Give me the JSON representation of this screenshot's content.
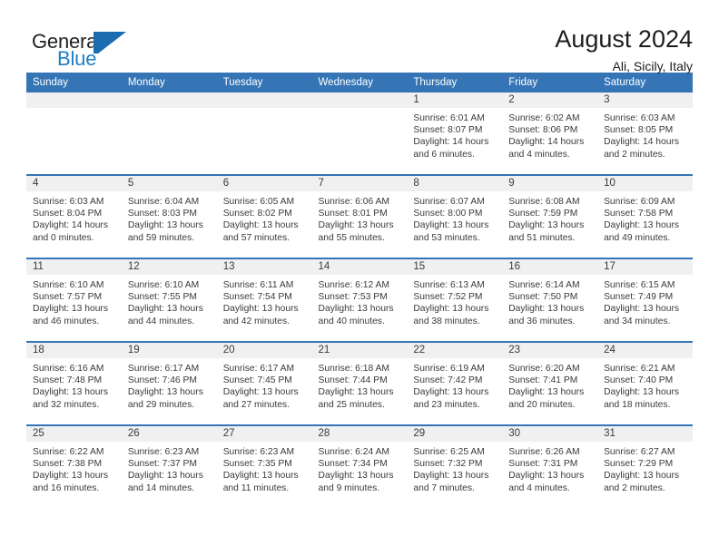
{
  "brand": {
    "name_top": "General",
    "name_bottom": "Blue",
    "logo_icon": "sail-triangle-icon",
    "accent_color": "#1f7fc4"
  },
  "header": {
    "title": "August 2024",
    "subtitle": "Ali, Sicily, Italy"
  },
  "theme": {
    "header_bg": "#3575b5",
    "header_text": "#ffffff",
    "daynum_bg": "#f0f0f0",
    "row_rule": "#3575b5"
  },
  "weekdays": [
    "Sunday",
    "Monday",
    "Tuesday",
    "Wednesday",
    "Thursday",
    "Friday",
    "Saturday"
  ],
  "weeks": [
    [
      {
        "empty": true
      },
      {
        "empty": true
      },
      {
        "empty": true
      },
      {
        "empty": true
      },
      {
        "day": "1",
        "sunrise": "Sunrise: 6:01 AM",
        "sunset": "Sunset: 8:07 PM",
        "daylight1": "Daylight: 14 hours",
        "daylight2": "and 6 minutes."
      },
      {
        "day": "2",
        "sunrise": "Sunrise: 6:02 AM",
        "sunset": "Sunset: 8:06 PM",
        "daylight1": "Daylight: 14 hours",
        "daylight2": "and 4 minutes."
      },
      {
        "day": "3",
        "sunrise": "Sunrise: 6:03 AM",
        "sunset": "Sunset: 8:05 PM",
        "daylight1": "Daylight: 14 hours",
        "daylight2": "and 2 minutes."
      }
    ],
    [
      {
        "day": "4",
        "sunrise": "Sunrise: 6:03 AM",
        "sunset": "Sunset: 8:04 PM",
        "daylight1": "Daylight: 14 hours",
        "daylight2": "and 0 minutes."
      },
      {
        "day": "5",
        "sunrise": "Sunrise: 6:04 AM",
        "sunset": "Sunset: 8:03 PM",
        "daylight1": "Daylight: 13 hours",
        "daylight2": "and 59 minutes."
      },
      {
        "day": "6",
        "sunrise": "Sunrise: 6:05 AM",
        "sunset": "Sunset: 8:02 PM",
        "daylight1": "Daylight: 13 hours",
        "daylight2": "and 57 minutes."
      },
      {
        "day": "7",
        "sunrise": "Sunrise: 6:06 AM",
        "sunset": "Sunset: 8:01 PM",
        "daylight1": "Daylight: 13 hours",
        "daylight2": "and 55 minutes."
      },
      {
        "day": "8",
        "sunrise": "Sunrise: 6:07 AM",
        "sunset": "Sunset: 8:00 PM",
        "daylight1": "Daylight: 13 hours",
        "daylight2": "and 53 minutes."
      },
      {
        "day": "9",
        "sunrise": "Sunrise: 6:08 AM",
        "sunset": "Sunset: 7:59 PM",
        "daylight1": "Daylight: 13 hours",
        "daylight2": "and 51 minutes."
      },
      {
        "day": "10",
        "sunrise": "Sunrise: 6:09 AM",
        "sunset": "Sunset: 7:58 PM",
        "daylight1": "Daylight: 13 hours",
        "daylight2": "and 49 minutes."
      }
    ],
    [
      {
        "day": "11",
        "sunrise": "Sunrise: 6:10 AM",
        "sunset": "Sunset: 7:57 PM",
        "daylight1": "Daylight: 13 hours",
        "daylight2": "and 46 minutes."
      },
      {
        "day": "12",
        "sunrise": "Sunrise: 6:10 AM",
        "sunset": "Sunset: 7:55 PM",
        "daylight1": "Daylight: 13 hours",
        "daylight2": "and 44 minutes."
      },
      {
        "day": "13",
        "sunrise": "Sunrise: 6:11 AM",
        "sunset": "Sunset: 7:54 PM",
        "daylight1": "Daylight: 13 hours",
        "daylight2": "and 42 minutes."
      },
      {
        "day": "14",
        "sunrise": "Sunrise: 6:12 AM",
        "sunset": "Sunset: 7:53 PM",
        "daylight1": "Daylight: 13 hours",
        "daylight2": "and 40 minutes."
      },
      {
        "day": "15",
        "sunrise": "Sunrise: 6:13 AM",
        "sunset": "Sunset: 7:52 PM",
        "daylight1": "Daylight: 13 hours",
        "daylight2": "and 38 minutes."
      },
      {
        "day": "16",
        "sunrise": "Sunrise: 6:14 AM",
        "sunset": "Sunset: 7:50 PM",
        "daylight1": "Daylight: 13 hours",
        "daylight2": "and 36 minutes."
      },
      {
        "day": "17",
        "sunrise": "Sunrise: 6:15 AM",
        "sunset": "Sunset: 7:49 PM",
        "daylight1": "Daylight: 13 hours",
        "daylight2": "and 34 minutes."
      }
    ],
    [
      {
        "day": "18",
        "sunrise": "Sunrise: 6:16 AM",
        "sunset": "Sunset: 7:48 PM",
        "daylight1": "Daylight: 13 hours",
        "daylight2": "and 32 minutes."
      },
      {
        "day": "19",
        "sunrise": "Sunrise: 6:17 AM",
        "sunset": "Sunset: 7:46 PM",
        "daylight1": "Daylight: 13 hours",
        "daylight2": "and 29 minutes."
      },
      {
        "day": "20",
        "sunrise": "Sunrise: 6:17 AM",
        "sunset": "Sunset: 7:45 PM",
        "daylight1": "Daylight: 13 hours",
        "daylight2": "and 27 minutes."
      },
      {
        "day": "21",
        "sunrise": "Sunrise: 6:18 AM",
        "sunset": "Sunset: 7:44 PM",
        "daylight1": "Daylight: 13 hours",
        "daylight2": "and 25 minutes."
      },
      {
        "day": "22",
        "sunrise": "Sunrise: 6:19 AM",
        "sunset": "Sunset: 7:42 PM",
        "daylight1": "Daylight: 13 hours",
        "daylight2": "and 23 minutes."
      },
      {
        "day": "23",
        "sunrise": "Sunrise: 6:20 AM",
        "sunset": "Sunset: 7:41 PM",
        "daylight1": "Daylight: 13 hours",
        "daylight2": "and 20 minutes."
      },
      {
        "day": "24",
        "sunrise": "Sunrise: 6:21 AM",
        "sunset": "Sunset: 7:40 PM",
        "daylight1": "Daylight: 13 hours",
        "daylight2": "and 18 minutes."
      }
    ],
    [
      {
        "day": "25",
        "sunrise": "Sunrise: 6:22 AM",
        "sunset": "Sunset: 7:38 PM",
        "daylight1": "Daylight: 13 hours",
        "daylight2": "and 16 minutes."
      },
      {
        "day": "26",
        "sunrise": "Sunrise: 6:23 AM",
        "sunset": "Sunset: 7:37 PM",
        "daylight1": "Daylight: 13 hours",
        "daylight2": "and 14 minutes."
      },
      {
        "day": "27",
        "sunrise": "Sunrise: 6:23 AM",
        "sunset": "Sunset: 7:35 PM",
        "daylight1": "Daylight: 13 hours",
        "daylight2": "and 11 minutes."
      },
      {
        "day": "28",
        "sunrise": "Sunrise: 6:24 AM",
        "sunset": "Sunset: 7:34 PM",
        "daylight1": "Daylight: 13 hours",
        "daylight2": "and 9 minutes."
      },
      {
        "day": "29",
        "sunrise": "Sunrise: 6:25 AM",
        "sunset": "Sunset: 7:32 PM",
        "daylight1": "Daylight: 13 hours",
        "daylight2": "and 7 minutes."
      },
      {
        "day": "30",
        "sunrise": "Sunrise: 6:26 AM",
        "sunset": "Sunset: 7:31 PM",
        "daylight1": "Daylight: 13 hours",
        "daylight2": "and 4 minutes."
      },
      {
        "day": "31",
        "sunrise": "Sunrise: 6:27 AM",
        "sunset": "Sunset: 7:29 PM",
        "daylight1": "Daylight: 13 hours",
        "daylight2": "and 2 minutes."
      }
    ]
  ]
}
